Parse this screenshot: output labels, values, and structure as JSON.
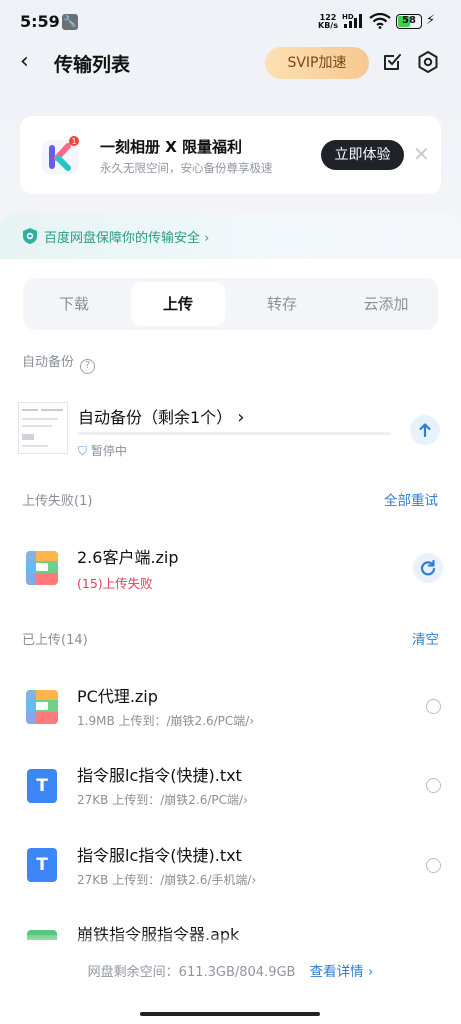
{
  "status_bar": {
    "time": "5:59",
    "net_speed_value": "122",
    "net_speed_unit": "KB/s",
    "network_label": "HD",
    "battery": "58",
    "battery_level": 0.58
  },
  "header": {
    "title": "传输列表",
    "svip_label": "SVIP加速"
  },
  "promo": {
    "title": "一刻相册 X 限量福利",
    "subtitle": "永久无限空间，安心备份尊享极速",
    "button_label": "立即体验",
    "badge": "1"
  },
  "security_banner": {
    "text": "百度网盘保障你的传输安全",
    "accent": "#2a9a84"
  },
  "tabs": [
    {
      "label": "下载",
      "active": false
    },
    {
      "label": "上传",
      "active": true
    },
    {
      "label": "转存",
      "active": false
    },
    {
      "label": "云添加",
      "active": false
    }
  ],
  "auto_backup": {
    "section_label": "自动备份",
    "title": "自动备份（剩余1个）",
    "status": "暂停中"
  },
  "failed_section": {
    "label": "上传失败(1)",
    "action": "全部重试",
    "items": [
      {
        "name": "2.6客户端.zip",
        "status": "(15)上传失败"
      }
    ]
  },
  "uploaded_section": {
    "label": "已上传(14)",
    "action": "清空",
    "items": [
      {
        "name": "PC代理.zip",
        "size": "1.9MB",
        "dest_prefix": "上传到：",
        "dest": "/崩铁2.6/PC端/",
        "icon": "zip-icon"
      },
      {
        "name": "指令服lc指令(快捷).txt",
        "size": "27KB",
        "dest_prefix": "上传到：",
        "dest": "/崩铁2.6/PC端/",
        "icon": "txt-icon"
      },
      {
        "name": "指令服lc指令(快捷).txt",
        "size": "27KB",
        "dest_prefix": "上传到：",
        "dest": "/崩铁2.6/手机端/",
        "icon": "txt-icon"
      },
      {
        "name": "崩铁指令服指令器.apk",
        "icon": "apk-icon"
      }
    ]
  },
  "footer": {
    "space_text": "网盘剩余空间：611.3GB/804.9GB",
    "details_link": "查看详情"
  },
  "colors": {
    "link": "#2f7dd6",
    "error": "#e0405a",
    "svip_gradient_start": "#fde0b2",
    "svip_gradient_end": "#f7c891"
  }
}
